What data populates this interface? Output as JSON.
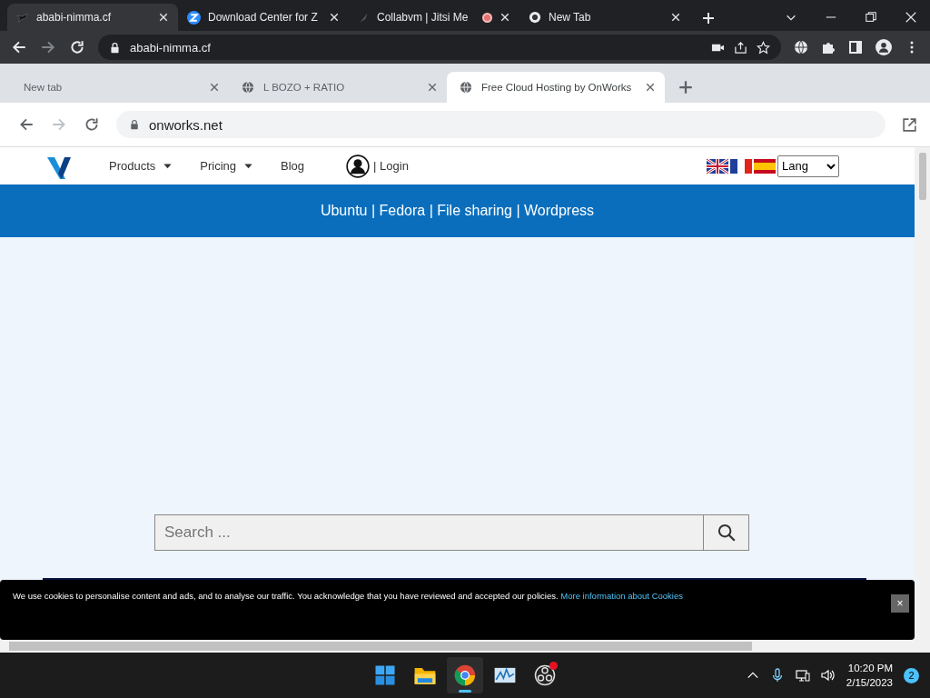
{
  "outer_tabs": [
    {
      "title": "ababi-nimma.cf",
      "selected": true,
      "recording": false
    },
    {
      "title": "Download Center for Z",
      "selected": false,
      "recording": false
    },
    {
      "title": "Collabvm | Jitsi Me",
      "selected": false,
      "recording": true
    },
    {
      "title": "New Tab",
      "selected": false,
      "recording": false
    }
  ],
  "outer_address": "ababi-nimma.cf",
  "inner_tabs": [
    {
      "title": "New tab",
      "selected": false
    },
    {
      "title": "L BOZO + RATIO",
      "selected": false
    },
    {
      "title": "Free Cloud Hosting by OnWorks",
      "selected": true
    }
  ],
  "inner_address": "onworks.net",
  "nav": {
    "items": [
      {
        "label": "Products",
        "dropdown": true
      },
      {
        "label": "Pricing",
        "dropdown": true
      },
      {
        "label": "Blog",
        "dropdown": false
      }
    ],
    "login": "| Login",
    "lang": "Lang"
  },
  "banner": "Ubuntu | Fedora | File sharing | Wordpress",
  "search": {
    "placeholder": "Search ..."
  },
  "cookie": {
    "text": "We use cookies to personalise content and ads, and to analyse our traffic. You acknowledge that you have reviewed and accepted our policies.",
    "link": "More information about Cookies",
    "close": "×"
  },
  "taskbar": {
    "apps": [
      {
        "selected": false
      },
      {
        "selected": false
      },
      {
        "selected": true
      },
      {
        "selected": false
      },
      {
        "selected": false,
        "badge": true
      }
    ],
    "time": "10:20 PM",
    "date": "2/15/2023",
    "notifications": "2"
  }
}
